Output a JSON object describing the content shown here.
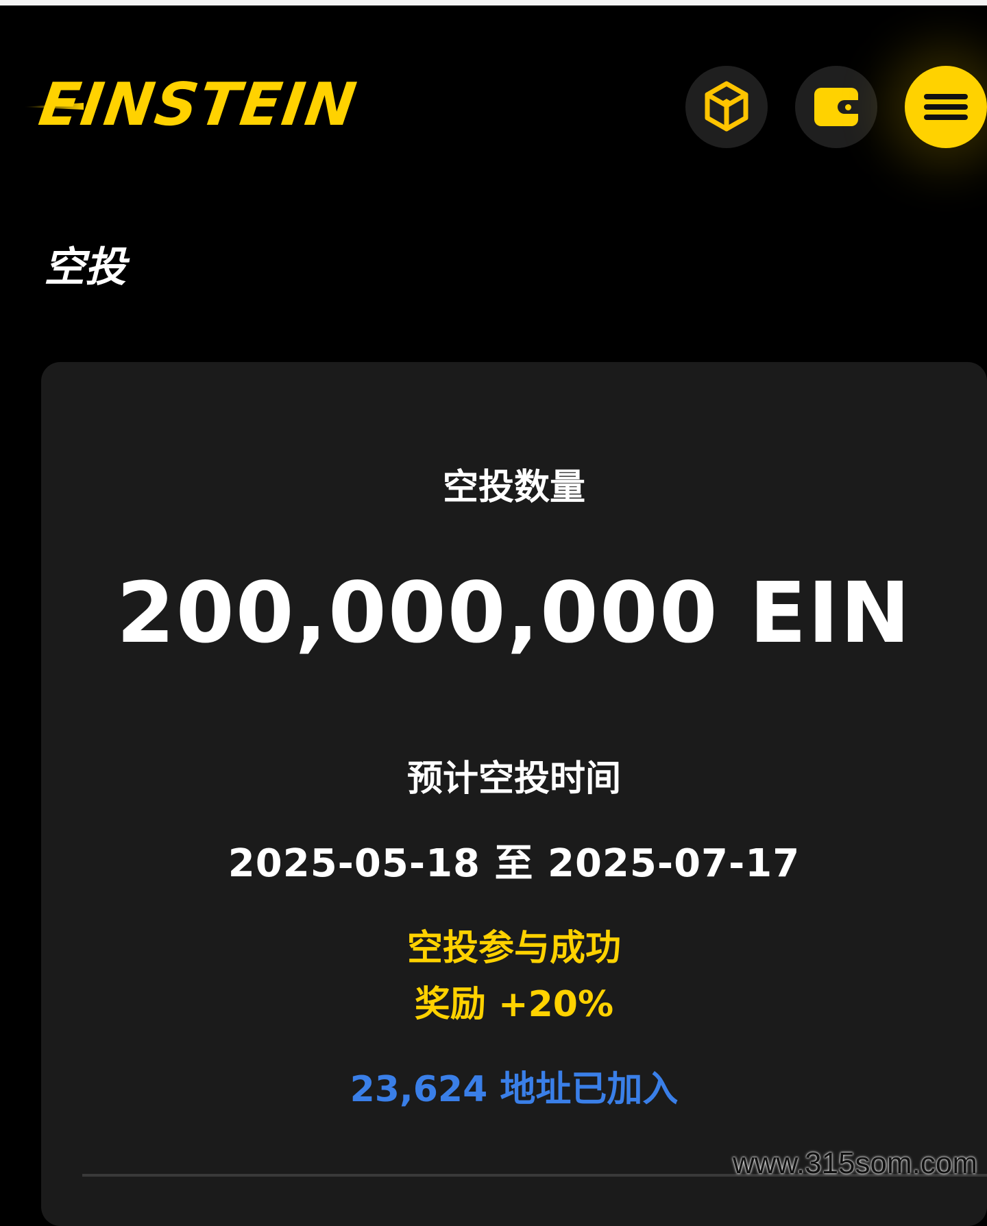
{
  "header": {
    "logo_text": "EINSTEIN",
    "bnb_icon": "bnb-chain-icon",
    "wallet_icon": "wallet-icon",
    "menu_icon": "hamburger-menu-icon"
  },
  "page": {
    "title": "空投"
  },
  "airdrop": {
    "amount_label": "空投数量",
    "amount_value": "200,000,000 EIN",
    "time_label": "预计空投时间",
    "time_range": "2025-05-18 至 2025-07-17",
    "success_text": "空投参与成功",
    "reward_text": "奖励 +20%",
    "addresses_joined": "23,624 地址已加入"
  },
  "watermark": "www.315som.com",
  "colors": {
    "background": "#000000",
    "card": "#1b1b1b",
    "accent_yellow": "#ffd200",
    "accent_blue": "#3a7fe8",
    "text": "#ffffff"
  }
}
